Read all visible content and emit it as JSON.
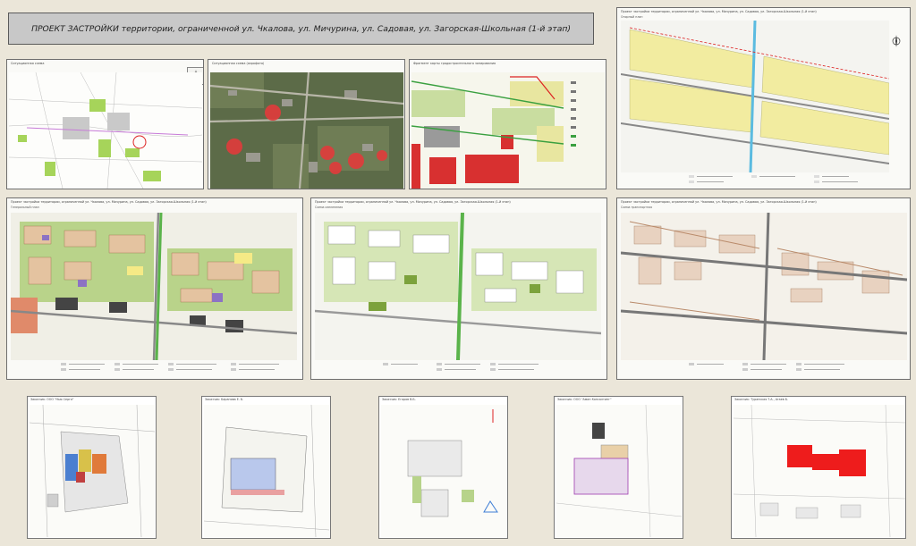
{
  "title": "ПРОЕКТ ЗАСТРОЙКИ территории, ограниченной ул. Чкалова, ул. Мичурина, ул. Садовая, ул. Загорская-Школьная (1-й этап)",
  "panels": {
    "situational": {
      "title": "Ситуационная схема"
    },
    "aerial": {
      "title": "Ситуационная схема (аэрофото)"
    },
    "fragment": {
      "title": "Фрагмент карты градостроительного зонирования"
    },
    "basis": {
      "title": "Проект застройки территории, ограниченной ул. Чкалова, ул. Мичурина, ул. Садовая, ул. Загорская-Школьная (1-й этап)",
      "subtitle": "Опорный план"
    },
    "plan_main": {
      "title": "Проект застройки территории, ограниченной ул. Чкалова, ул. Мичурина, ул. Садовая, ул. Загорская-Школьная (1-й этап)",
      "subtitle": "Генеральный план"
    },
    "plan_green": {
      "title": "Проект застройки территории, ограниченной ул. Чкалова, ул. Мичурина, ул. Садовая, ул. Загорская-Школьная (1-й этап)",
      "subtitle": "Схема озеленения"
    },
    "plan_roads": {
      "title": "Проект застройки территории, ограниченной ул. Чкалова, ул. Мичурина, ул. Садовая, ул. Загорская-Школьная (1-й этап)",
      "subtitle": "Схема транспортная"
    }
  },
  "cards": [
    {
      "title": "Заказчик: ООО \"Нью Серго\""
    },
    {
      "title": "Заказчик: Баранова Е. Б."
    },
    {
      "title": "Заказчик: Егоров В.Б."
    },
    {
      "title": "Заказчик: ООО \"Амин Консалтинг\""
    },
    {
      "title": "Заказчик: Туранская Т.А., Агаев Б."
    }
  ],
  "colors": {
    "background": "#ebe6d9",
    "banner": "#c8c8c8",
    "yellow_zone": "#f2eca0",
    "green": "#8fb84a",
    "red": "#e02020",
    "brown_road": "#b98a6a"
  },
  "icons": [
    "compass-rose-icon"
  ]
}
